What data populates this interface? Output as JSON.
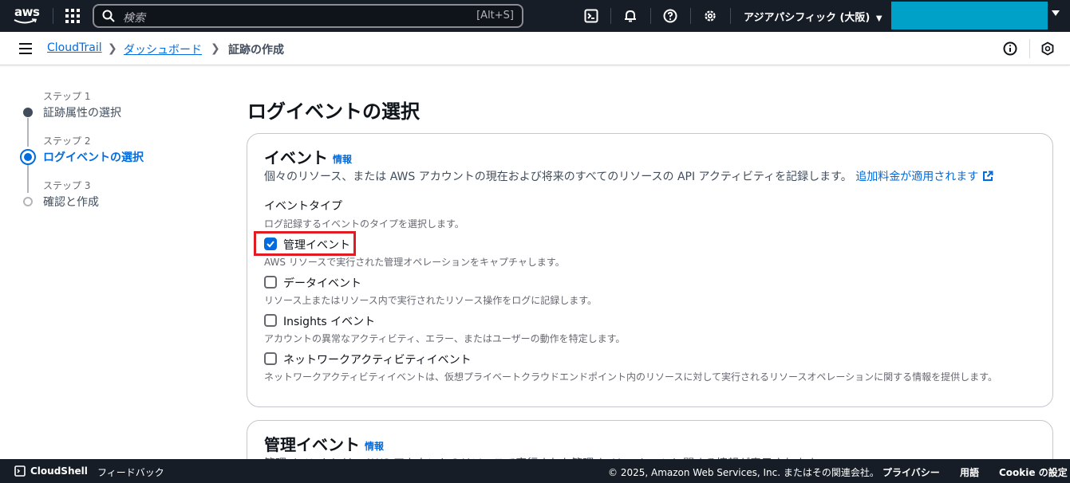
{
  "topnav": {
    "logo_text": "aws",
    "search_placeholder": "検索",
    "search_shortcut": "[Alt+S]",
    "region": "アジアパシフィック (大阪)",
    "icons": [
      "cloudshell-icon",
      "bell-icon",
      "help-icon",
      "settings-icon"
    ],
    "account_color": "#00a1c9"
  },
  "breadcrumb": {
    "items": [
      "CloudTrail",
      "ダッシュボード",
      "証跡の作成"
    ]
  },
  "stepper": {
    "steps": [
      {
        "label": "ステップ 1",
        "name": "証跡属性の選択",
        "state": "completed"
      },
      {
        "label": "ステップ 2",
        "name": "ログイベントの選択",
        "state": "active"
      },
      {
        "label": "ステップ 3",
        "name": "確認と作成",
        "state": "pending"
      }
    ]
  },
  "main": {
    "title": "ログイベントの選択",
    "events_card": {
      "heading": "イベント",
      "info": "情報",
      "description": "個々のリソース、または AWS アカウントの現在および将来のすべてのリソースの API アクティビティを記録します。",
      "link": "追加料金が適用されます",
      "event_type_label": "イベントタイプ",
      "event_type_desc": "ログ記録するイベントのタイプを選択します。",
      "options": [
        {
          "label": "管理イベント",
          "desc": "AWS リソースで実行された管理オペレーションをキャプチャします。",
          "checked": true
        },
        {
          "label": "データイベント",
          "desc": "リソース上またはリソース内で実行されたリソース操作をログに記録します。",
          "checked": false
        },
        {
          "label": "Insights イベント",
          "desc": "アカウントの異常なアクティビティ、エラー、またはユーザーの動作を特定します。",
          "checked": false
        },
        {
          "label": "ネットワークアクティビティイベント",
          "desc": "ネットワークアクティビティイベントは、仮想プライベートクラウドエンドポイント内のリソースに対して実行されるリソースオペレーションに関する情報を提供します。",
          "checked": false
        }
      ]
    },
    "mgmt_card": {
      "heading": "管理イベント",
      "info": "情報",
      "description": "管理イベントには、AWS アカウントのリソースで実行された管理オペレーションに関する情報が表示されます。"
    }
  },
  "footer": {
    "cloudshell": "CloudShell",
    "feedback": "フィードバック",
    "copyright": "© 2025, Amazon Web Services, Inc. またはその関連会社。",
    "privacy": "プライバシー",
    "terms": "用語",
    "cookie": "Cookie の設定"
  },
  "colors": {
    "nav_bg": "#161d26",
    "link": "#006ce0",
    "highlight": "#e01b22"
  }
}
